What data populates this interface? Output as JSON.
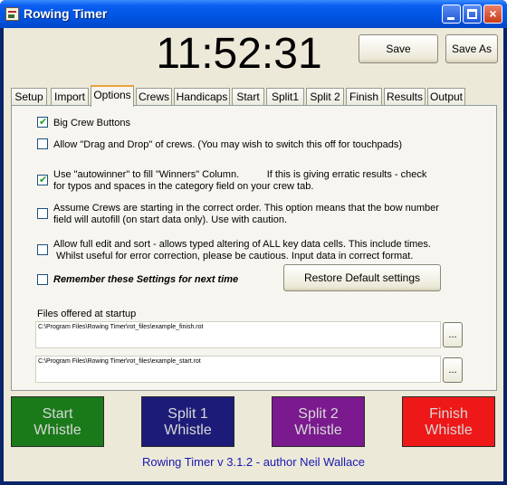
{
  "window": {
    "title": "Rowing Timer"
  },
  "clock": "11:52:31",
  "toolbar": {
    "save_label": "Save",
    "save_as_label": "Save As"
  },
  "tabs": [
    {
      "label": "Setup"
    },
    {
      "label": "Import"
    },
    {
      "label": "Options",
      "active": true
    },
    {
      "label": "Crews"
    },
    {
      "label": "Handicaps"
    },
    {
      "label": "Start"
    },
    {
      "label": "Split1"
    },
    {
      "label": "Split 2"
    },
    {
      "label": "Finish"
    },
    {
      "label": "Results"
    },
    {
      "label": "Output"
    }
  ],
  "options": {
    "big_crew_buttons": {
      "checked": true,
      "label": "Big Crew Buttons"
    },
    "drag_drop": {
      "checked": false,
      "label": "Allow \"Drag and Drop\" of crews.  (You may wish to switch this off for touchpads)"
    },
    "autowinner": {
      "checked": true,
      "line1": "Use \"autowinner\" to fill \"Winners\" Column.          If this is giving erratic results - check",
      "line2": "for typos and spaces in the category field on your crew tab."
    },
    "assume_crews": {
      "checked": false,
      "line1": "Assume Crews are starting in the correct order.  This option means that the bow number",
      "line2": "field will autofill (on start data only). Use with caution."
    },
    "full_edit": {
      "checked": false,
      "line1": "Allow full edit and sort - allows typed altering of ALL key data cells. This include times.",
      "line2": " Whilst useful for error correction, please be cautious. Input data in correct format."
    },
    "remember": {
      "checked": false,
      "label": "Remember these Settings for next time"
    },
    "restore_label": "Restore Default settings"
  },
  "files": {
    "label": "Files offered at startup",
    "finish_path": "C:\\Program  Files\\Rowing  Timer\\rot_files\\example_finish.rot",
    "start_path": "C:\\Program  Files\\Rowing  Timer\\rot_files\\example_start.rot",
    "browse_label": "..."
  },
  "whistles": {
    "start": [
      "Start",
      "Whistle"
    ],
    "split1": [
      "Split 1",
      "Whistle"
    ],
    "split2": [
      "Split 2",
      "Whistle"
    ],
    "finish": [
      "Finish",
      "Whistle"
    ],
    "colors": {
      "start": "#1a7a1a",
      "split1": "#1c1c78",
      "split2": "#7a1a8e",
      "finish": "#ee1818"
    }
  },
  "footer": "Rowing Timer v 3.1.2 - author Neil Wallace",
  "icons": {
    "app": "rowing-timer-app-icon",
    "check": "✔"
  }
}
